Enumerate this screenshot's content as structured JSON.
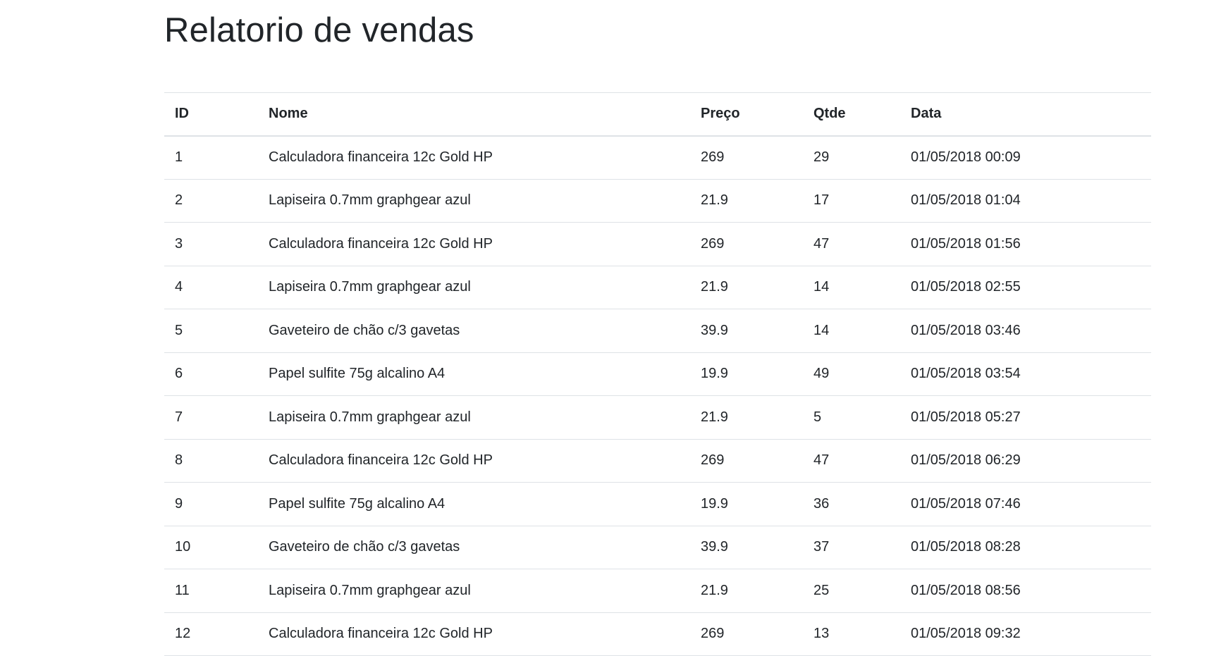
{
  "page": {
    "title": "Relatorio de vendas"
  },
  "table": {
    "headers": {
      "id": "ID",
      "nome": "Nome",
      "preco": "Preço",
      "qtde": "Qtde",
      "data": "Data"
    },
    "rows": [
      {
        "id": "1",
        "nome": "Calculadora financeira 12c Gold HP",
        "preco": "269",
        "qtde": "29",
        "data": "01/05/2018 00:09"
      },
      {
        "id": "2",
        "nome": "Lapiseira 0.7mm graphgear azul",
        "preco": "21.9",
        "qtde": "17",
        "data": "01/05/2018 01:04"
      },
      {
        "id": "3",
        "nome": "Calculadora financeira 12c Gold HP",
        "preco": "269",
        "qtde": "47",
        "data": "01/05/2018 01:56"
      },
      {
        "id": "4",
        "nome": "Lapiseira 0.7mm graphgear azul",
        "preco": "21.9",
        "qtde": "14",
        "data": "01/05/2018 02:55"
      },
      {
        "id": "5",
        "nome": "Gaveteiro de chão c/3 gavetas",
        "preco": "39.9",
        "qtde": "14",
        "data": "01/05/2018 03:46"
      },
      {
        "id": "6",
        "nome": "Papel sulfite 75g alcalino A4",
        "preco": "19.9",
        "qtde": "49",
        "data": "01/05/2018 03:54"
      },
      {
        "id": "7",
        "nome": "Lapiseira 0.7mm graphgear azul",
        "preco": "21.9",
        "qtde": "5",
        "data": "01/05/2018 05:27"
      },
      {
        "id": "8",
        "nome": "Calculadora financeira 12c Gold HP",
        "preco": "269",
        "qtde": "47",
        "data": "01/05/2018 06:29"
      },
      {
        "id": "9",
        "nome": "Papel sulfite 75g alcalino A4",
        "preco": "19.9",
        "qtde": "36",
        "data": "01/05/2018 07:46"
      },
      {
        "id": "10",
        "nome": "Gaveteiro de chão c/3 gavetas",
        "preco": "39.9",
        "qtde": "37",
        "data": "01/05/2018 08:28"
      },
      {
        "id": "11",
        "nome": "Lapiseira 0.7mm graphgear azul",
        "preco": "21.9",
        "qtde": "25",
        "data": "01/05/2018 08:56"
      },
      {
        "id": "12",
        "nome": "Calculadora financeira 12c Gold HP",
        "preco": "269",
        "qtde": "13",
        "data": "01/05/2018 09:32"
      }
    ]
  }
}
